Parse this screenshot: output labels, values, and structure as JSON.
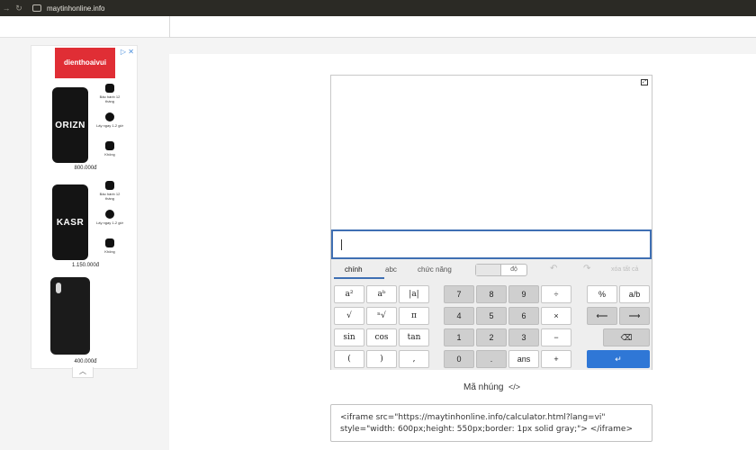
{
  "browser": {
    "url": "maytinhonline.info",
    "back_icon": "arrow-right-icon",
    "reload_icon": "reload-icon"
  },
  "ad": {
    "adchoice": "▷ ✕",
    "brand": "dienthoaivui",
    "products": [
      {
        "model": "ORIZN",
        "price": "800.000đ",
        "features": [
          "Bảo hành 12 tháng",
          "Lấy ngay 1-2 giờ",
          "Không"
        ]
      },
      {
        "model": "KASR",
        "price": "1.150.000đ",
        "features": [
          "Bảo hành 12 tháng",
          "Lấy ngay 1-2 giờ",
          "Không"
        ]
      },
      {
        "model": "",
        "price": "400.000đ",
        "features": []
      }
    ],
    "scroll_up": "︿"
  },
  "calculator": {
    "expand_icon": "⤢",
    "tabs": [
      "chính",
      "abc",
      "chức năng"
    ],
    "angle_mode": "độ",
    "clear_all": "xóa tất cả",
    "keys": {
      "func": [
        [
          "a²",
          "aᵇ",
          "|a|"
        ],
        [
          "√",
          "ⁿ√",
          "π"
        ],
        [
          "sin",
          "cos",
          "tan"
        ],
        [
          "(",
          ")",
          ","
        ]
      ],
      "num": [
        [
          "7",
          "8",
          "9",
          "÷"
        ],
        [
          "4",
          "5",
          "6",
          "×"
        ],
        [
          "1",
          "2",
          "3",
          "−"
        ],
        [
          "0",
          ".",
          "ans",
          "+"
        ]
      ],
      "side": [
        [
          "%",
          "a/b"
        ],
        [
          "⟵",
          "⟶"
        ],
        [
          "⌫"
        ],
        [
          "↵"
        ]
      ]
    }
  },
  "embed": {
    "label": "Mã nhúng",
    "icon": "</>",
    "code_line1": "<iframe src=\"https://maytinhonline.info/calculator.html?lang=vi\"",
    "code_line2": "style=\"width: 600px;height: 550px;border: 1px solid gray;\"> </iframe>"
  }
}
